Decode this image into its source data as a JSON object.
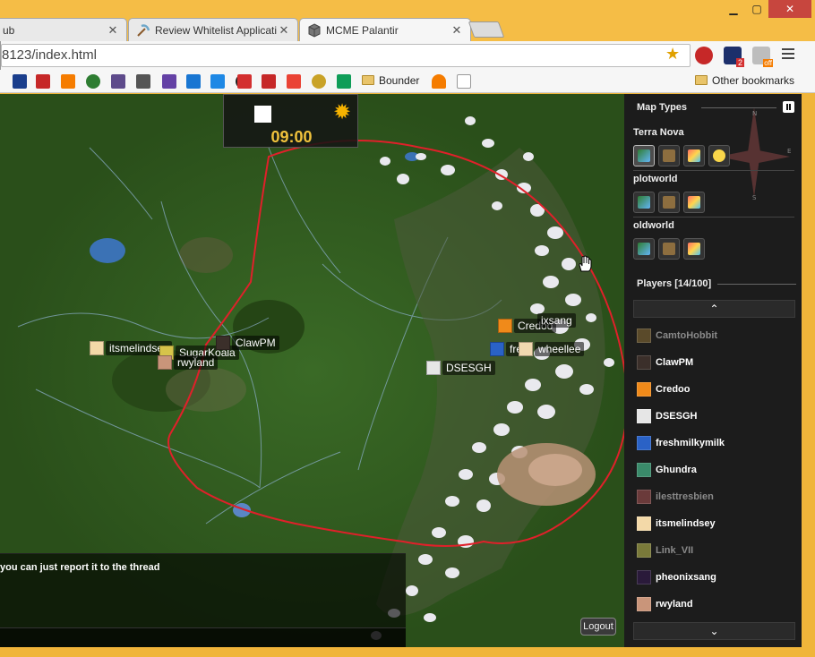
{
  "browser": {
    "tabs": [
      {
        "title": "ub",
        "favicon": "page-icon"
      },
      {
        "title": "Review Whitelist Applicati",
        "favicon": "pickaxe-icon"
      },
      {
        "title": "MCME Palantir",
        "favicon": "cube-icon"
      }
    ],
    "address": "8123/index.html",
    "bookmark_labels": {
      "bounder": "Bounder",
      "other": "Other bookmarks"
    },
    "extension_badge": "2",
    "extension_off": "off"
  },
  "map": {
    "clock": {
      "time": "09:00"
    },
    "players_on_map": [
      {
        "name": "itsmelindsey",
        "display": "itsmelindsey"
      },
      {
        "name": "SugarKoala",
        "display": "SugarKoala"
      },
      {
        "name": "ClawPM",
        "display": "ClawPM"
      },
      {
        "name": "rwyland",
        "display": "rwyland"
      },
      {
        "name": "Credoo",
        "display": "Credoo"
      },
      {
        "name": "pheonixsang",
        "display": "ixsang"
      },
      {
        "name": "freshmilkymilk",
        "display": "fre"
      },
      {
        "name": "wheellee",
        "display": "wheellee"
      },
      {
        "name": "DSESGH",
        "display": "DSESGH"
      }
    ],
    "chat_message": "you can just report it to the thread",
    "logout_label": "Logout",
    "accent_color": "#e0202a"
  },
  "sidebar": {
    "map_types_title": "Map Types",
    "worlds": [
      {
        "name": "Terra Nova",
        "maps": [
          "flat-icon",
          "surface-icon",
          "cave-icon",
          "sun-icon"
        ]
      },
      {
        "name": "plotworld",
        "maps": [
          "flat-icon",
          "surface-icon",
          "cave-icon"
        ]
      },
      {
        "name": "oldworld",
        "maps": [
          "flat-icon",
          "surface-icon",
          "cave-icon"
        ]
      }
    ],
    "players_title": "Players [14/100]",
    "players": [
      {
        "name": "CamtoHobbit",
        "dim": true
      },
      {
        "name": "ClawPM",
        "dim": false
      },
      {
        "name": "Credoo",
        "dim": false
      },
      {
        "name": "DSESGH",
        "dim": false
      },
      {
        "name": "freshmilkymilk",
        "dim": false
      },
      {
        "name": "Ghundra",
        "dim": false
      },
      {
        "name": "ilesttresbien",
        "dim": true
      },
      {
        "name": "itsmelindsey",
        "dim": false
      },
      {
        "name": "Link_VII",
        "dim": true
      },
      {
        "name": "pheonixsang",
        "dim": false
      },
      {
        "name": "rwyland",
        "dim": false
      }
    ]
  }
}
